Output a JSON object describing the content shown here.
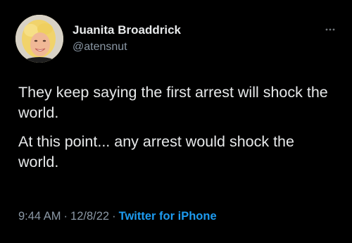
{
  "tweet": {
    "author": {
      "name": "Juanita Broaddrick",
      "handle": "@atensnut"
    },
    "more_icon": "more-dots-icon",
    "text": [
      "They keep saying the first arrest will shock the world.",
      "At this point... any arrest would shock the world."
    ],
    "meta": {
      "time": "9:44 AM",
      "separator": "·",
      "date": "12/8/22",
      "source": "Twitter for iPhone"
    }
  },
  "colors": {
    "background": "#000000",
    "text_primary": "#e7e9ea",
    "text_secondary": "#8b98a5",
    "link": "#1d9bf0"
  }
}
